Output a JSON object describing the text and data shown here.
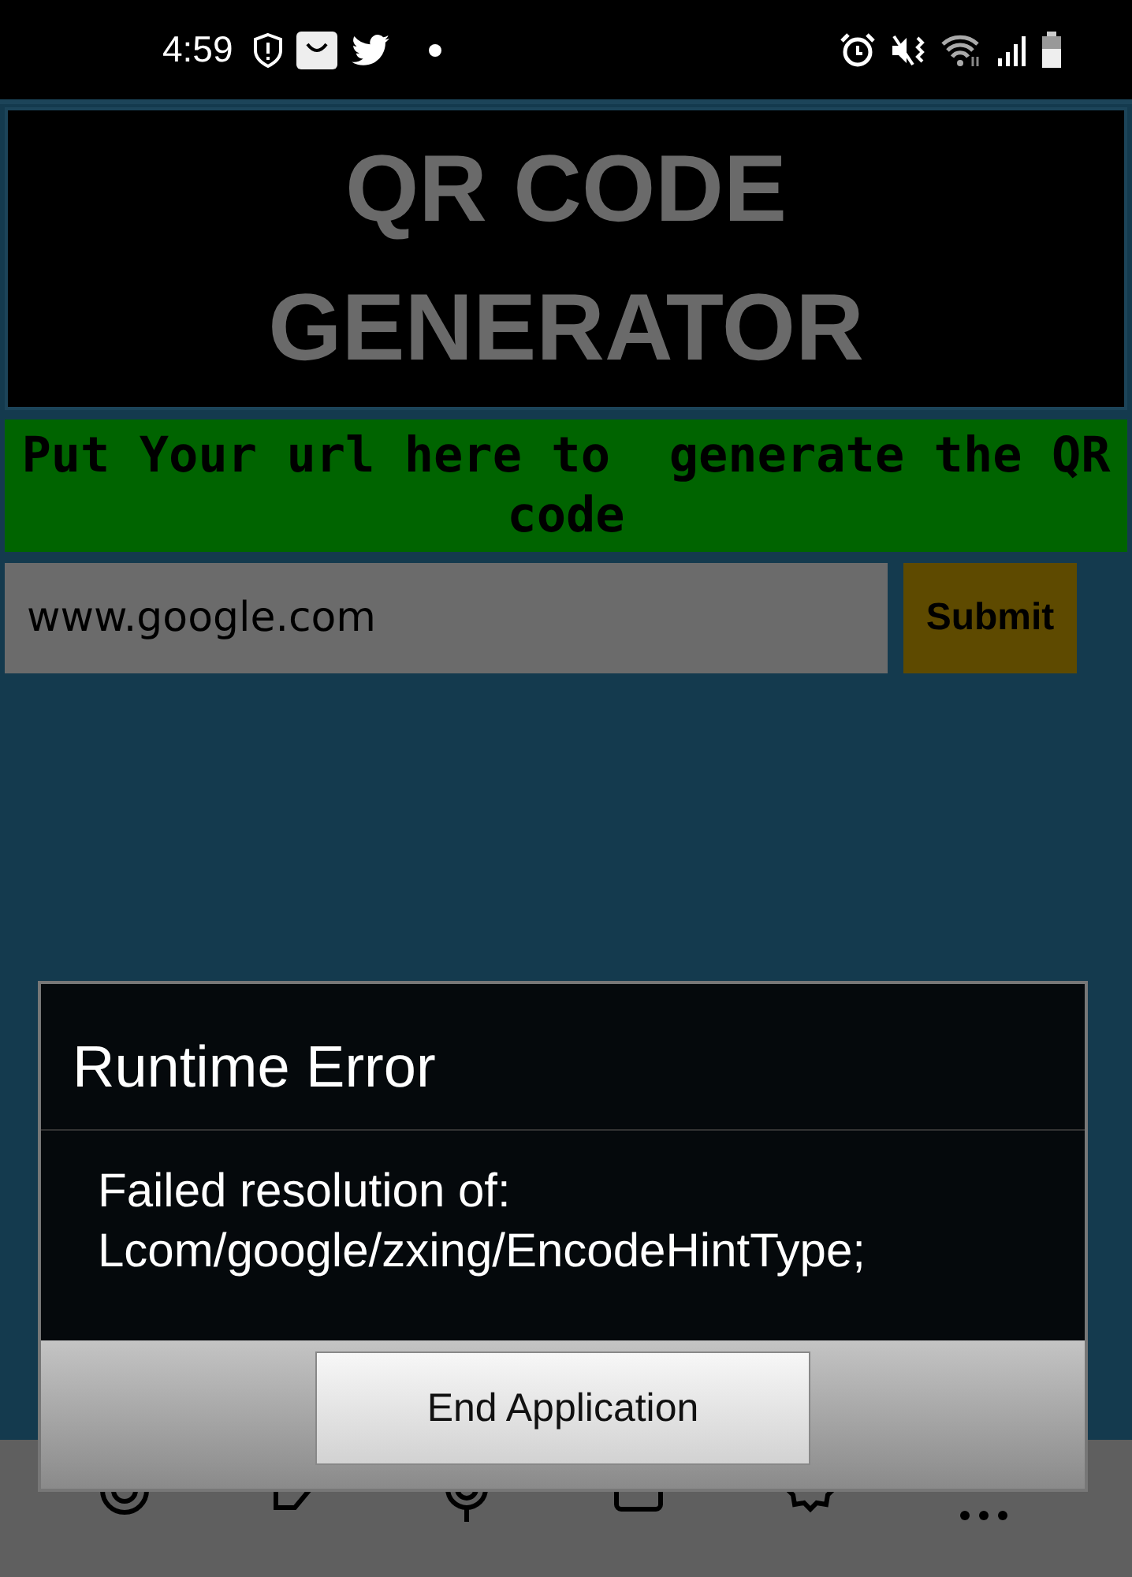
{
  "status_bar": {
    "time": "4:59"
  },
  "app": {
    "title": "QR CODE GENERATOR",
    "prompt": "Put Your url here to  generate the QR code",
    "url_field": {
      "value": "www.google.com"
    },
    "submit_button": "Submit"
  },
  "dialog": {
    "title": "Runtime Error",
    "message": "Failed resolution of: Lcom/google/zxing/EncodeHintType;",
    "button": "End Application"
  }
}
